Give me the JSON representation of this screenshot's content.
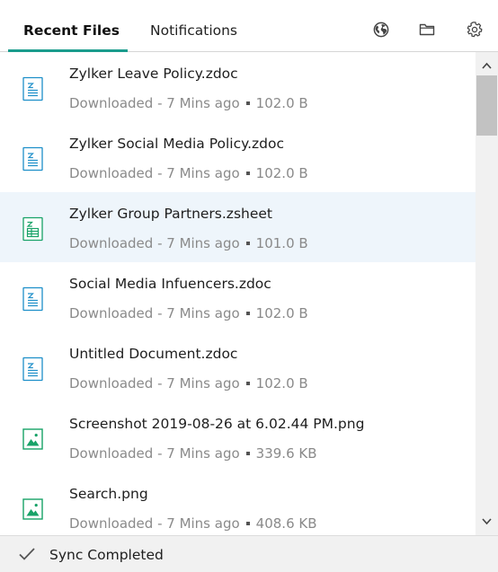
{
  "tabs": {
    "recent": "Recent Files",
    "notifications": "Notifications"
  },
  "header_icons": [
    "globe-icon",
    "folder-icon",
    "gear-icon"
  ],
  "colors": {
    "accent": "#1a9c8d",
    "doc_icon": "#1d8fc9",
    "sheet_icon": "#17a267",
    "image_icon": "#17a267",
    "selected_row": "#eef5fb"
  },
  "files": [
    {
      "name": "Zylker Leave Policy.zdoc",
      "status": "Downloaded - 7 Mins ago",
      "size": "102.0 B",
      "type": "doc",
      "icon": "document-icon"
    },
    {
      "name": "Zylker Social Media Policy.zdoc",
      "status": "Downloaded - 7 Mins ago",
      "size": "102.0 B",
      "type": "doc",
      "icon": "document-icon"
    },
    {
      "name": "Zylker Group Partners.zsheet",
      "status": "Downloaded - 7 Mins ago",
      "size": "101.0 B",
      "type": "sheet",
      "icon": "spreadsheet-icon",
      "selected": true
    },
    {
      "name": "Social Media Infuencers.zdoc",
      "status": "Downloaded - 7 Mins ago",
      "size": "102.0 B",
      "type": "doc",
      "icon": "document-icon"
    },
    {
      "name": "Untitled Document.zdoc",
      "status": "Downloaded - 7 Mins ago",
      "size": "102.0 B",
      "type": "doc",
      "icon": "document-icon"
    },
    {
      "name": "Screenshot 2019-08-26 at 6.02.44 PM.png",
      "status": "Downloaded - 7 Mins ago",
      "size": "339.6 KB",
      "type": "image",
      "icon": "image-icon"
    },
    {
      "name": "Search.png",
      "status": "Downloaded - 7 Mins ago",
      "size": "408.6 KB",
      "type": "image",
      "icon": "image-icon"
    }
  ],
  "footer": {
    "status": "Sync Completed",
    "icon": "checkmark-icon"
  }
}
